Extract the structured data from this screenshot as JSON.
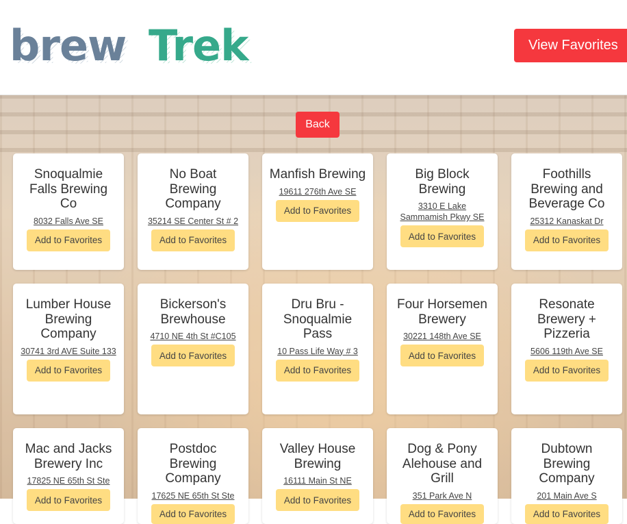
{
  "header": {
    "logo": {
      "part1": "brew",
      "part2": "Trek",
      "color1": "#6a8199",
      "color2": "#36a98b"
    },
    "favorites_label": "View Favorites"
  },
  "back_label": "Back",
  "add_label": "Add to Favorites",
  "colors": {
    "accent": "#f5383e",
    "favorite_button": "#ffdd82"
  },
  "breweries": [
    {
      "name": "Snoqualmie Falls Brewing Co",
      "address": "8032 Falls Ave SE"
    },
    {
      "name": "No Boat Brewing Company",
      "address": "35214 SE Center St # 2"
    },
    {
      "name": "Manfish Brewing",
      "address": "19611 276th Ave SE"
    },
    {
      "name": "Big Block Brewing",
      "address": "3310 E Lake Sammamish Pkwy SE"
    },
    {
      "name": "Foothills Brewing and Beverage Co",
      "address": "25312 Kanaskat Dr"
    },
    {
      "name": "Lumber House Brewing Company",
      "address": "30741 3rd AVE Suite 133"
    },
    {
      "name": "Bickerson's Brewhouse",
      "address": "4710 NE 4th St #C105"
    },
    {
      "name": "Dru Bru - Snoqualmie Pass",
      "address": "10 Pass Life Way # 3"
    },
    {
      "name": "Four Horsemen Brewery",
      "address": "30221 148th Ave SE"
    },
    {
      "name": "Resonate Brewery + Pizzeria",
      "address": "5606 119th Ave SE"
    },
    {
      "name": "Mac and Jacks Brewery Inc",
      "address": "17825 NE 65th St Ste"
    },
    {
      "name": "Postdoc Brewing Company",
      "address": "17625 NE 65th St Ste"
    },
    {
      "name": "Valley House Brewing",
      "address": "16111 Main St NE"
    },
    {
      "name": "Dog & Pony Alehouse and Grill",
      "address": "351 Park Ave N"
    },
    {
      "name": "Dubtown Brewing Company",
      "address": "201 Main Ave S"
    }
  ]
}
